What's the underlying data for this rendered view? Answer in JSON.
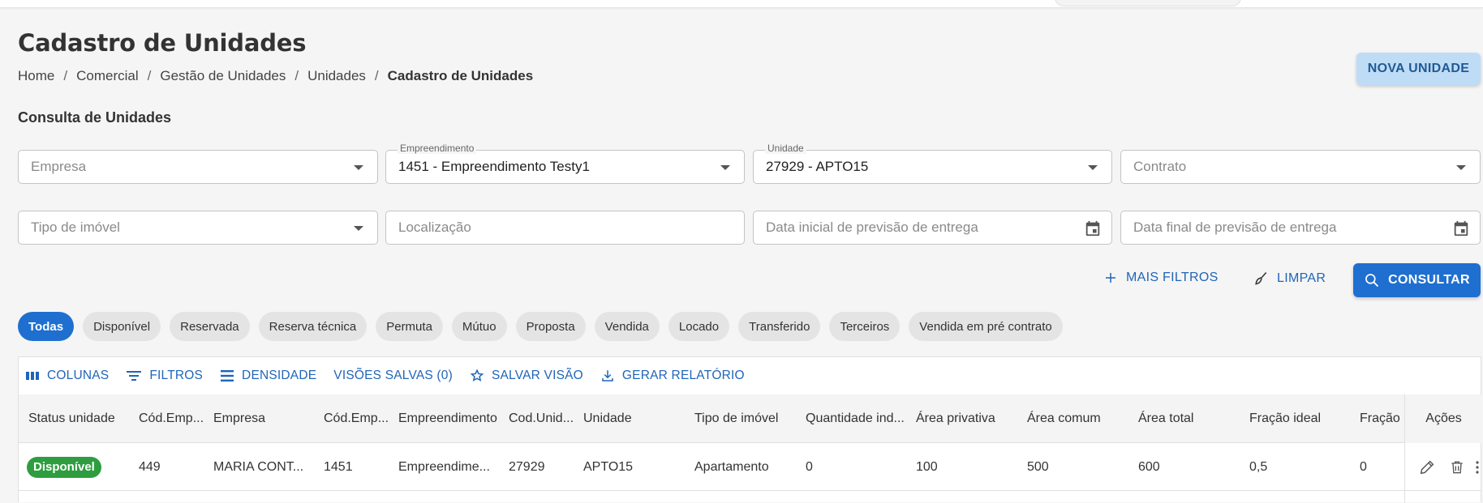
{
  "header": {
    "title": "Cadastro de Unidades",
    "new_button": "NOVA UNIDADE",
    "breadcrumb": [
      "Home",
      "Comercial",
      "Gestão de Unidades",
      "Unidades",
      "Cadastro de Unidades"
    ],
    "breadcrumb_separator": "/"
  },
  "search": {
    "section_title": "Consulta de Unidades",
    "empresa": {
      "placeholder": "Empresa",
      "value": ""
    },
    "empreendimento": {
      "label": "Empreendimento",
      "value": "1451 - Empreendimento Testy1"
    },
    "unidade": {
      "label": "Unidade",
      "value": "27929 - APTO15"
    },
    "contrato": {
      "placeholder": "Contrato",
      "value": ""
    },
    "tipo_imovel": {
      "placeholder": "Tipo de imóvel",
      "value": ""
    },
    "localizacao": {
      "placeholder": "Localização",
      "value": ""
    },
    "data_inicial": {
      "placeholder": "Data inicial de previsão de entrega",
      "value": ""
    },
    "data_final": {
      "placeholder": "Data final de previsão de entrega",
      "value": ""
    },
    "more_filters": "MAIS FILTROS",
    "clear": "LIMPAR",
    "submit": "CONSULTAR"
  },
  "status_chips": [
    "Todas",
    "Disponível",
    "Reservada",
    "Reserva técnica",
    "Permuta",
    "Mútuo",
    "Proposta",
    "Vendida",
    "Locado",
    "Transferido",
    "Terceiros",
    "Vendida em pré contrato"
  ],
  "active_chip": "Todas",
  "grid": {
    "toolbar": {
      "columns": "COLUNAS",
      "filters": "FILTROS",
      "density": "DENSIDADE",
      "saved_views": "VISÕES SALVAS (0)",
      "save_view": "SALVAR VISÃO",
      "report": "GERAR RELATÓRIO"
    },
    "headers": [
      "Status unidade",
      "Cód.Emp...",
      "Empresa",
      "Cód.Emp...",
      "Empreendimento",
      "Cod.Unid...",
      "Unidade",
      "Tipo de imóvel",
      "Quantidade ind...",
      "Área privativa",
      "Área comum",
      "Área total",
      "Fração ideal",
      "Fração i"
    ],
    "actions_header": "Ações",
    "rows": [
      {
        "status": "Disponível",
        "cells": [
          "449",
          "MARIA CONT...",
          "1451",
          "Empreendime...",
          "27929",
          "APTO15",
          "Apartamento",
          "0",
          "100",
          "500",
          "600",
          "0,5",
          "0"
        ]
      }
    ]
  },
  "colors": {
    "primary": "#1e6fd0",
    "link": "#1f65b8",
    "status_available": "#2e9d3f",
    "new_button_bg": "#bfdcf7"
  }
}
